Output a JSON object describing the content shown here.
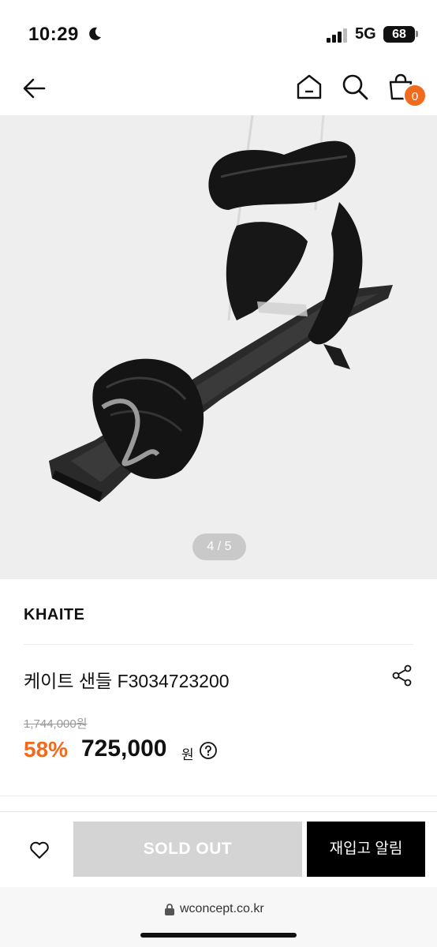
{
  "status_bar": {
    "time": "10:29",
    "network": "5G",
    "battery": "68"
  },
  "nav": {
    "cart_count": "0"
  },
  "gallery": {
    "pager": "4 / 5"
  },
  "product": {
    "brand": "KHAITE",
    "name": "케이트 샌들 F3034723200",
    "original_price": "1,744,000원",
    "discount": "58%",
    "sale_price": "725,000",
    "currency": "원"
  },
  "actions": {
    "sold_out_label": "SOLD OUT",
    "restock_label": "재입고 알림"
  },
  "browser": {
    "url": "wconcept.co.kr"
  },
  "colors": {
    "accent": "#f06b1e",
    "sold_out_bg": "#d4d4d4",
    "primary_button_bg": "#000000"
  },
  "icons": [
    "moon-icon",
    "signal-icon",
    "back-arrow-icon",
    "home-icon",
    "search-icon",
    "cart-icon",
    "share-icon",
    "help-icon",
    "heart-icon",
    "lock-icon"
  ]
}
